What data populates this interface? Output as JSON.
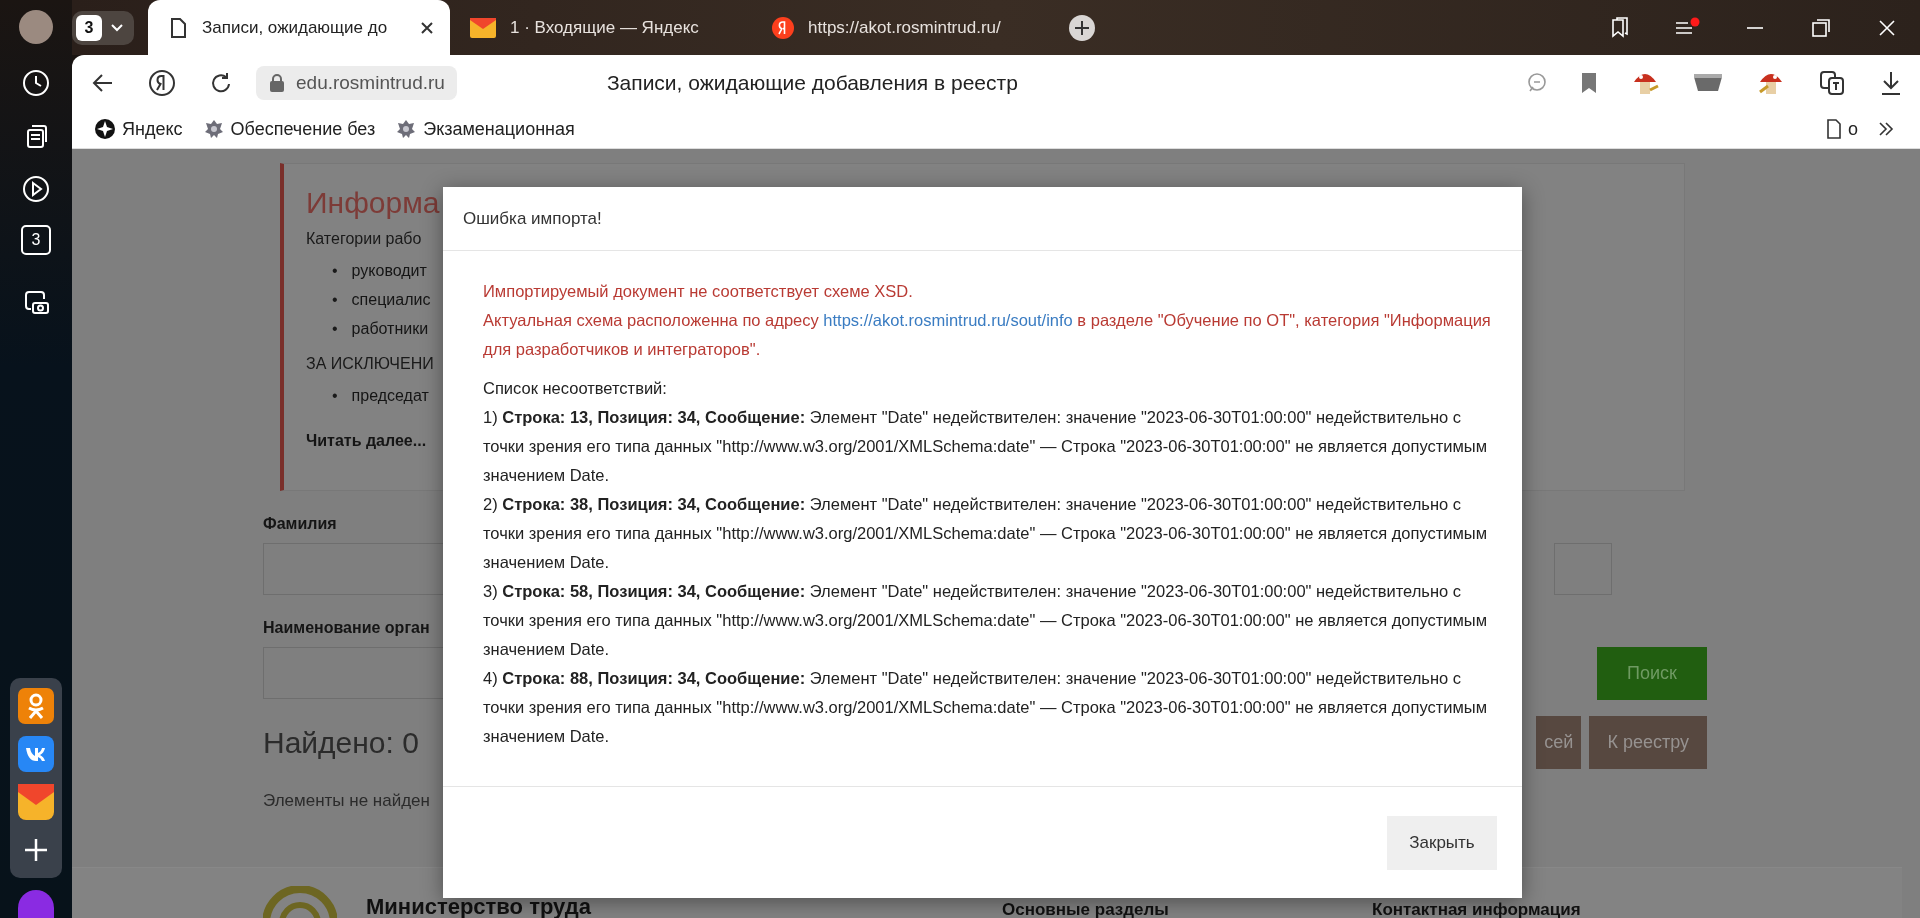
{
  "sidebar": {
    "tab_count": "3"
  },
  "tab_strip": {
    "group_count": "3",
    "tabs": [
      {
        "kind": "page",
        "title": "Записи, ожидающие до",
        "selected": true
      },
      {
        "kind": "mail",
        "title": "1 · Входящие — Яндекс",
        "selected": false
      },
      {
        "kind": "yandex",
        "title": "https://akot.rosmintrud.ru/",
        "selected": false
      }
    ]
  },
  "toolbar": {
    "address": "edu.rosmintrud.ru",
    "page_title": "Записи, ожидающие добавления в реестр"
  },
  "bookmarks": {
    "items": [
      {
        "kind": "yandex",
        "label": "Яндекс"
      },
      {
        "kind": "emblem",
        "label": "Обеспечение без"
      },
      {
        "kind": "emblem",
        "label": "Экзаменационная"
      }
    ],
    "other": "о"
  },
  "page": {
    "info": {
      "marker": "•",
      "heading": "Информа",
      "intro": "Категории рабо",
      "items": [
        "руководит",
        "специалис",
        "работники"
      ],
      "exception": "ЗА ИСКЛЮЧЕНИ",
      "exception_items": [
        "председат"
      ],
      "read_more": "Читать далее..."
    },
    "form": {
      "fields": [
        {
          "label": "Фамилия"
        },
        {
          "label": "Наименование орган"
        }
      ],
      "search_button": "Поиск",
      "buttons": [
        "сей",
        "К реестру"
      ]
    },
    "found": "Найдено: 0",
    "empty": "Элементы не найден",
    "footer": {
      "title": "Министерство труда",
      "columns": [
        "Основные разделы",
        "Контактная информация"
      ]
    }
  },
  "dialog": {
    "title": "Ошибка импорта!",
    "error": "Импортируемый документ не соответствует схеме XSD.",
    "schema_before": "Актуальная схема расположенна по адресу",
    "schema_link": "https://akot.rosmintrud.ru/sout/info",
    "schema_after": "в разделе \"Обучение по ОТ\", категория \"Информация для разработчиков и интеграторов\".",
    "list_title": "Список несоответствий:",
    "items": [
      "1) **Строка: 13, Позиция: 34, Сообщение:** Элемент \"Date\" недействителен: значение \"2023-06-30T01:00:00\" недействительно с точки зрения его типа данных \"http://www.w3.org/2001/XMLSchema:date\" — Строка \"2023-06-30T01:00:00\" не является допустимым значением Date.",
      "2) **Строка: 38, Позиция: 34, Сообщение:** Элемент \"Date\" недействителен: значение \"2023-06-30T01:00:00\" недействительно с точки зрения его типа данных \"http://www.w3.org/2001/XMLSchema:date\" — Строка \"2023-06-30T01:00:00\" не является допустимым значением Date.",
      "3) **Строка: 58, Позиция: 34, Сообщение:** Элемент \"Date\" недействителен: значение \"2023-06-30T01:00:00\" недействительно с точки зрения его типа данных \"http://www.w3.org/2001/XMLSchema:date\" — Строка \"2023-06-30T01:00:00\" не является допустимым значением Date.",
      "4) **Строка: 88, Позиция: 34, Сообщение:** Элемент \"Date\" недействителен: значение \"2023-06-30T01:00:00\" недействительно с точки зрения его типа данных \"http://www.w3.org/2001/XMLSchema:date\" — Строка \"2023-06-30T01:00:00\" не является допустимым значением Date."
    ],
    "close": "Закрыть"
  }
}
